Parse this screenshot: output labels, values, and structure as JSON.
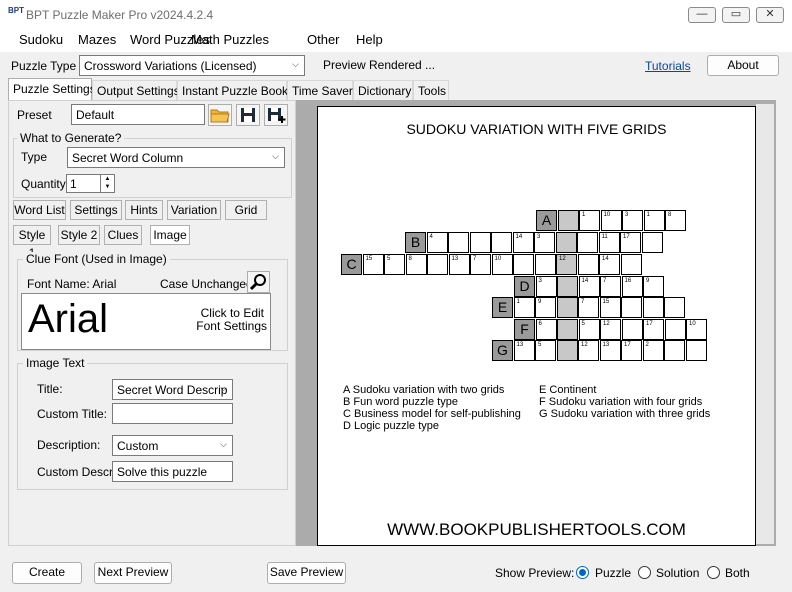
{
  "window": {
    "title": "BPT Puzzle Maker Pro v2024.4.2.4",
    "app_icon_text": "BPT"
  },
  "menu": [
    "Sudoku",
    "Mazes",
    "Word Puzzles",
    "Math Puzzles",
    "Other",
    "Help"
  ],
  "toolbar": {
    "puzzle_type_label": "Puzzle Type",
    "puzzle_type_value": "Crossword Variations (Licensed)",
    "status": "Preview Rendered ...",
    "tutorials_link": "Tutorials",
    "about_button": "About"
  },
  "tabs": [
    "Puzzle Settings",
    "Output Settings",
    "Instant Puzzle Books",
    "Time Saver",
    "Dictionary",
    "Tools"
  ],
  "settings": {
    "preset_label": "Preset",
    "preset_value": "Default",
    "what_to_generate_label": "What to Generate?",
    "type_label": "Type",
    "type_value": "Secret Word Column",
    "quantity_label": "Quantity",
    "quantity_value": "1",
    "subtabs_row1": [
      "Word List",
      "Settings",
      "Hints",
      "Variation",
      "Grid"
    ],
    "subtabs_row2": [
      "Style 1",
      "Style 2",
      "Clues",
      "Image"
    ],
    "clue_font_label": "Clue Font (Used in Image)",
    "font_name_label": "Font Name: Arial",
    "case_label": "Case Unchanged",
    "font_sample": "Arial",
    "font_hint_line1": "Click to Edit",
    "font_hint_line2": "Font Settings",
    "image_text_label": "Image Text",
    "title_label": "Title:",
    "title_value": "Secret Word Descrip",
    "custom_title_label": "Custom Title:",
    "custom_title_value": "",
    "description_label": "Description:",
    "description_value": "Custom",
    "custom_descr_label": "Custom Descr:",
    "custom_descr_value": "Solve this puzzle"
  },
  "preview": {
    "puzzle_title": "SUDOKU VARIATION WITH FIVE GRIDS",
    "rows": [
      {
        "letter": "A",
        "numbers": [
          "",
          "1",
          "10",
          "3",
          "1",
          "8"
        ]
      },
      {
        "letter": "B",
        "numbers": [
          "4",
          "",
          "",
          "",
          "14",
          "3",
          "",
          "",
          "11",
          "17",
          ""
        ]
      },
      {
        "letter": "C",
        "numbers": [
          "15",
          "5",
          "8",
          "",
          "13",
          "7",
          "10",
          "",
          "",
          "12",
          "",
          "14",
          ""
        ]
      },
      {
        "letter": "D",
        "numbers": [
          "3",
          "",
          "14",
          "7",
          "16",
          "9"
        ]
      },
      {
        "letter": "E",
        "numbers": [
          "1",
          "9",
          "",
          "7",
          "15",
          "",
          "",
          ""
        ]
      },
      {
        "letter": "F",
        "numbers": [
          "6",
          "",
          "5",
          "12",
          "",
          "17",
          "",
          "10"
        ]
      },
      {
        "letter": "G",
        "numbers": [
          "13",
          "5",
          "",
          "12",
          "13",
          "17",
          "2",
          "",
          ""
        ]
      }
    ],
    "clues_left": [
      "A Sudoku variation with two grids",
      "B Fun word puzzle type",
      "C Business model for self-publishing",
      "D Logic puzzle type"
    ],
    "clues_right": [
      "E Continent",
      "F Sudoku variation with four grids",
      "G Sudoku variation with three grids"
    ],
    "website": "WWW.BOOKPUBLISHERTOOLS.COM"
  },
  "bottom": {
    "create_button": "Create",
    "next_preview_button": "Next Preview",
    "save_preview_button": "Save Preview",
    "show_preview_label": "Show Preview:",
    "options": [
      "Puzzle",
      "Solution",
      "Both"
    ],
    "selected": "Puzzle"
  }
}
